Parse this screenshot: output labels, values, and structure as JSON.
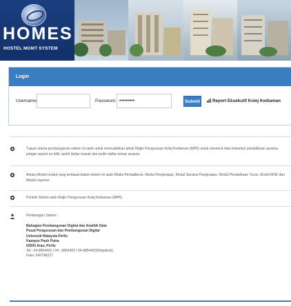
{
  "banner": {
    "logo_text": "HOMES",
    "tagline": "HOSTEL MGMT SYSTEM"
  },
  "login": {
    "title": "Login",
    "username_label": "Username:",
    "username_value": "",
    "password_label": "Password:",
    "password_value": "•••••••••",
    "submit_label": "Submit",
    "report_label": "Report Eksekutif Kolej Kediaman"
  },
  "info": {
    "items": [
      {
        "icon": "info-icon",
        "text": "Tujuan utama pembangunan sistem ini ialah untuk memudahkan pihak Majlis Pengurusan Kolej Kediaman (MPK) untuk merekod data berkaitan pendaftaran asrama pelajar seperti no bilik, tarikh daftar masuk dan tarikh daftar keluar asrama."
      },
      {
        "icon": "info-icon",
        "text": "Antara Modul-modul yang terdapat dalam sistem ini ialah Modul Pentadbiran, Modul Penginapan, Modul Senarai Penginapan, Modul Pendaftaran Yuran, Modul MSK dan Modul Laporan."
      },
      {
        "icon": "info-icon",
        "text": "Pemilik Sistem ialah Majlis Pengurusan Kolej Kediaman (MPK)"
      }
    ],
    "developer": {
      "icon": "user-icon",
      "heading": "Pembangun Sistem :",
      "lines": [
        "Bahagian Pembangunan Digital dan Analitik Data",
        "Pusat Pengurusan dan Pembangunan Digital",
        "Universiti Malaysia Perlis",
        "Kampus Pauh Putra",
        "02600 Arau, Perlis"
      ],
      "tel": "Tel : 04-9854401 / 04 - 9854402 / 04-9854403(Helpdesk)",
      "fax": "Faks: 049798227"
    }
  },
  "colors": {
    "accent": "#3a7dc0",
    "banner_dark": "#163a78"
  }
}
